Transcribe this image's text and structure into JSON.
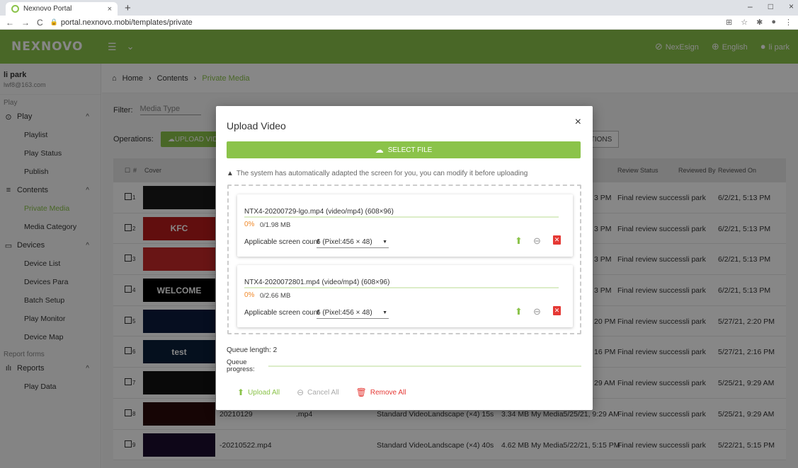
{
  "browser": {
    "tab_title": "Nexnovo Portal",
    "tab_close": "×",
    "new_tab": "+",
    "url": "portal.nexnovo.mobi/templates/private",
    "win_min": "–",
    "win_max": "□",
    "win_close": "×"
  },
  "topnav": {
    "logo": "NEXNOVO",
    "nexesign": "NexEsign",
    "language": "English",
    "user": "li park"
  },
  "sidebar": {
    "user_name": "li park",
    "user_email": "lwf8@163.com",
    "section_play": "Play",
    "play": "Play",
    "playlist": "Playlist",
    "play_status": "Play Status",
    "publish": "Publish",
    "contents": "Contents",
    "private_media": "Private Media",
    "media_category": "Media Category",
    "devices": "Devices",
    "device_list": "Device List",
    "devices_para": "Devices Para",
    "batch_setup": "Batch Setup",
    "play_monitor": "Play Monitor",
    "device_map": "Device Map",
    "section_report": "Report forms",
    "reports": "Reports",
    "play_data": "Play Data"
  },
  "main": {
    "crumb_home": "Home",
    "crumb_contents": "Contents",
    "crumb_current": "Private Media",
    "filter_label": "Filter:",
    "filter_placeholder": "Media Type",
    "operations_label": "Operations:",
    "upload_video": "UPLOAD VIDEO",
    "actions_btn": "TIONS",
    "headers": {
      "num": "#",
      "cover": "Cover",
      "review_status": "Review Status",
      "reviewed_by": "Reviewed By",
      "reviewed_on": "Reviewed On"
    },
    "rows": [
      {
        "num": "1",
        "thumb": "",
        "time": "3 PM",
        "status": "Final review successli park",
        "reviewed_on": "6/2/21, 5:13 PM"
      },
      {
        "num": "2",
        "thumb": "KFC",
        "time": "3 PM",
        "status": "Final review successli park",
        "reviewed_on": "6/2/21, 5:13 PM"
      },
      {
        "num": "3",
        "thumb": "",
        "time": "3 PM",
        "status": "Final review successli park",
        "reviewed_on": "6/2/21, 5:13 PM"
      },
      {
        "num": "4",
        "thumb": "WELCOME",
        "time": "3 PM",
        "status": "Final review successli park",
        "reviewed_on": "6/2/21, 5:13 PM"
      },
      {
        "num": "5",
        "thumb": "",
        "time": "20 PM",
        "status": "Final review successli park",
        "reviewed_on": "5/27/21, 2:20 PM"
      },
      {
        "num": "6",
        "thumb": "test",
        "time": "16 PM",
        "status": "Final review successli park",
        "reviewed_on": "5/27/21, 2:16 PM"
      },
      {
        "num": "7",
        "thumb": "",
        "time": "29 AM",
        "status": "Final review successli park",
        "reviewed_on": "5/25/21, 9:29 AM"
      },
      {
        "num": "8",
        "thumb": "",
        "name": "20210129",
        "ext": ".mp4",
        "type": "Standard VideoLandscape (×4)  15s",
        "size": "3.34 MB  My Media5/25/21, 9:29 AM",
        "status": "Final review successli park",
        "reviewed_on": "5/25/21, 9:29 AM"
      },
      {
        "num": "9",
        "thumb": "",
        "name": "-20210522.mp4",
        "type": "Standard VideoLandscape (×4)  40s",
        "size": "4.62 MB  My Media5/22/21, 5:15 PM",
        "status": "Final review successli park",
        "reviewed_on": "5/22/21, 5:15 PM"
      }
    ]
  },
  "dialog": {
    "title": "Upload Video",
    "close": "×",
    "select_file": "SELECT FILE",
    "notice": "The system has automatically adapted the screen for you, you can modify it before uploading",
    "files": [
      {
        "name": "NTX4-20200729-lgo.mp4 (video/mp4)  (608×96)",
        "pct": "0%",
        "size": "0/1.98 MB",
        "progress": 0,
        "screen_label": "Applicable screen count",
        "screen_value": "6 (Pixel:456 × 48)"
      },
      {
        "name": "NTX4-2020072801.mp4 (video/mp4)  (608×96)",
        "pct": "0%",
        "size": "0/2.66 MB",
        "progress": 0,
        "screen_label": "Applicable screen count",
        "screen_value": "6 (Pixel:456 × 48)"
      }
    ],
    "queue_length": "Queue length: 2",
    "queue_progress_label": "Queue progress:",
    "queue_progress": 0,
    "upload_all": "Upload All",
    "cancel_all": "Cancel All",
    "remove_all": "Remove All"
  }
}
